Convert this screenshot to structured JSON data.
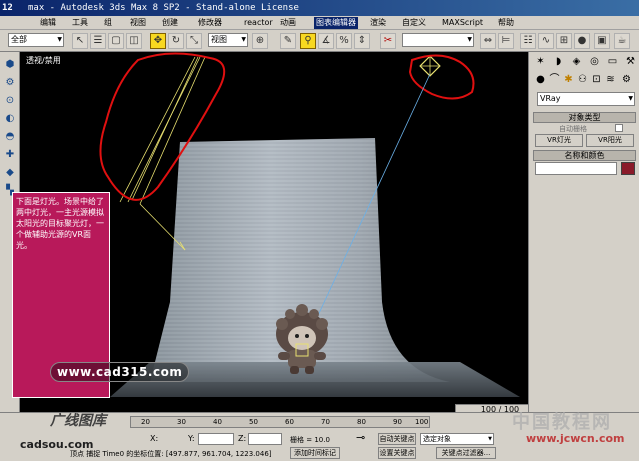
{
  "title_bar": {
    "number": "12",
    "title": "max - Autodesk 3ds Max 8 SP2  - Stand-alone License"
  },
  "menu": [
    {
      "label": "编辑"
    },
    {
      "label": "工具"
    },
    {
      "label": "组"
    },
    {
      "label": "视图"
    },
    {
      "label": "创建"
    },
    {
      "label": "修改器"
    },
    {
      "label": "reactor"
    },
    {
      "label": "动画"
    },
    {
      "label": "图表编辑器"
    },
    {
      "label": "渲染"
    },
    {
      "label": "自定义"
    },
    {
      "label": "MAXScript"
    },
    {
      "label": "帮助"
    }
  ],
  "toolbar": {
    "selection_filter": "全部",
    "coord_system": "视图"
  },
  "viewport": {
    "label": "透视/禁用",
    "frame_counter": "100 / 100"
  },
  "command_panel": {
    "category_dropdown": "VRay",
    "rollout_object_type": "对象类型",
    "auto_grid_label": "自动栅格",
    "buttons": [
      "VR灯光",
      "VR阳光"
    ],
    "rollout_name_color": "名称和颜色",
    "object_color": "#8a1a2a"
  },
  "annotation": {
    "text": "下面是灯光。场景中给了两中灯光，一主光源模拟太阳光的目标聚光灯，一个做辅助光源的VR面光。"
  },
  "timeline": {
    "ticks": [
      "20",
      "30",
      "40",
      "50",
      "60",
      "70",
      "80",
      "90",
      "100"
    ]
  },
  "status": {
    "x_label": "X:",
    "y_label": "Y:",
    "z_label": "Z:",
    "grid_text": "栅格 = 10.0",
    "auto_key_label": "自动关键点",
    "selected_dropdown": "选定对象",
    "set_key_label": "设置关键点",
    "key_filter_label": "关键点过滤器...",
    "bottom_line": "顶点  捕捉 Time0  的坐标位置: [497.877, 961.704, 1223.046]",
    "add_time_tag": "添加时间标记"
  },
  "watermarks": {
    "site": "www.cad315.com",
    "logo_text": "广线图库",
    "logo_sub": "cadsou.com",
    "cn_site": "中国教程网",
    "cn_url": "www.jcwcn.com"
  }
}
